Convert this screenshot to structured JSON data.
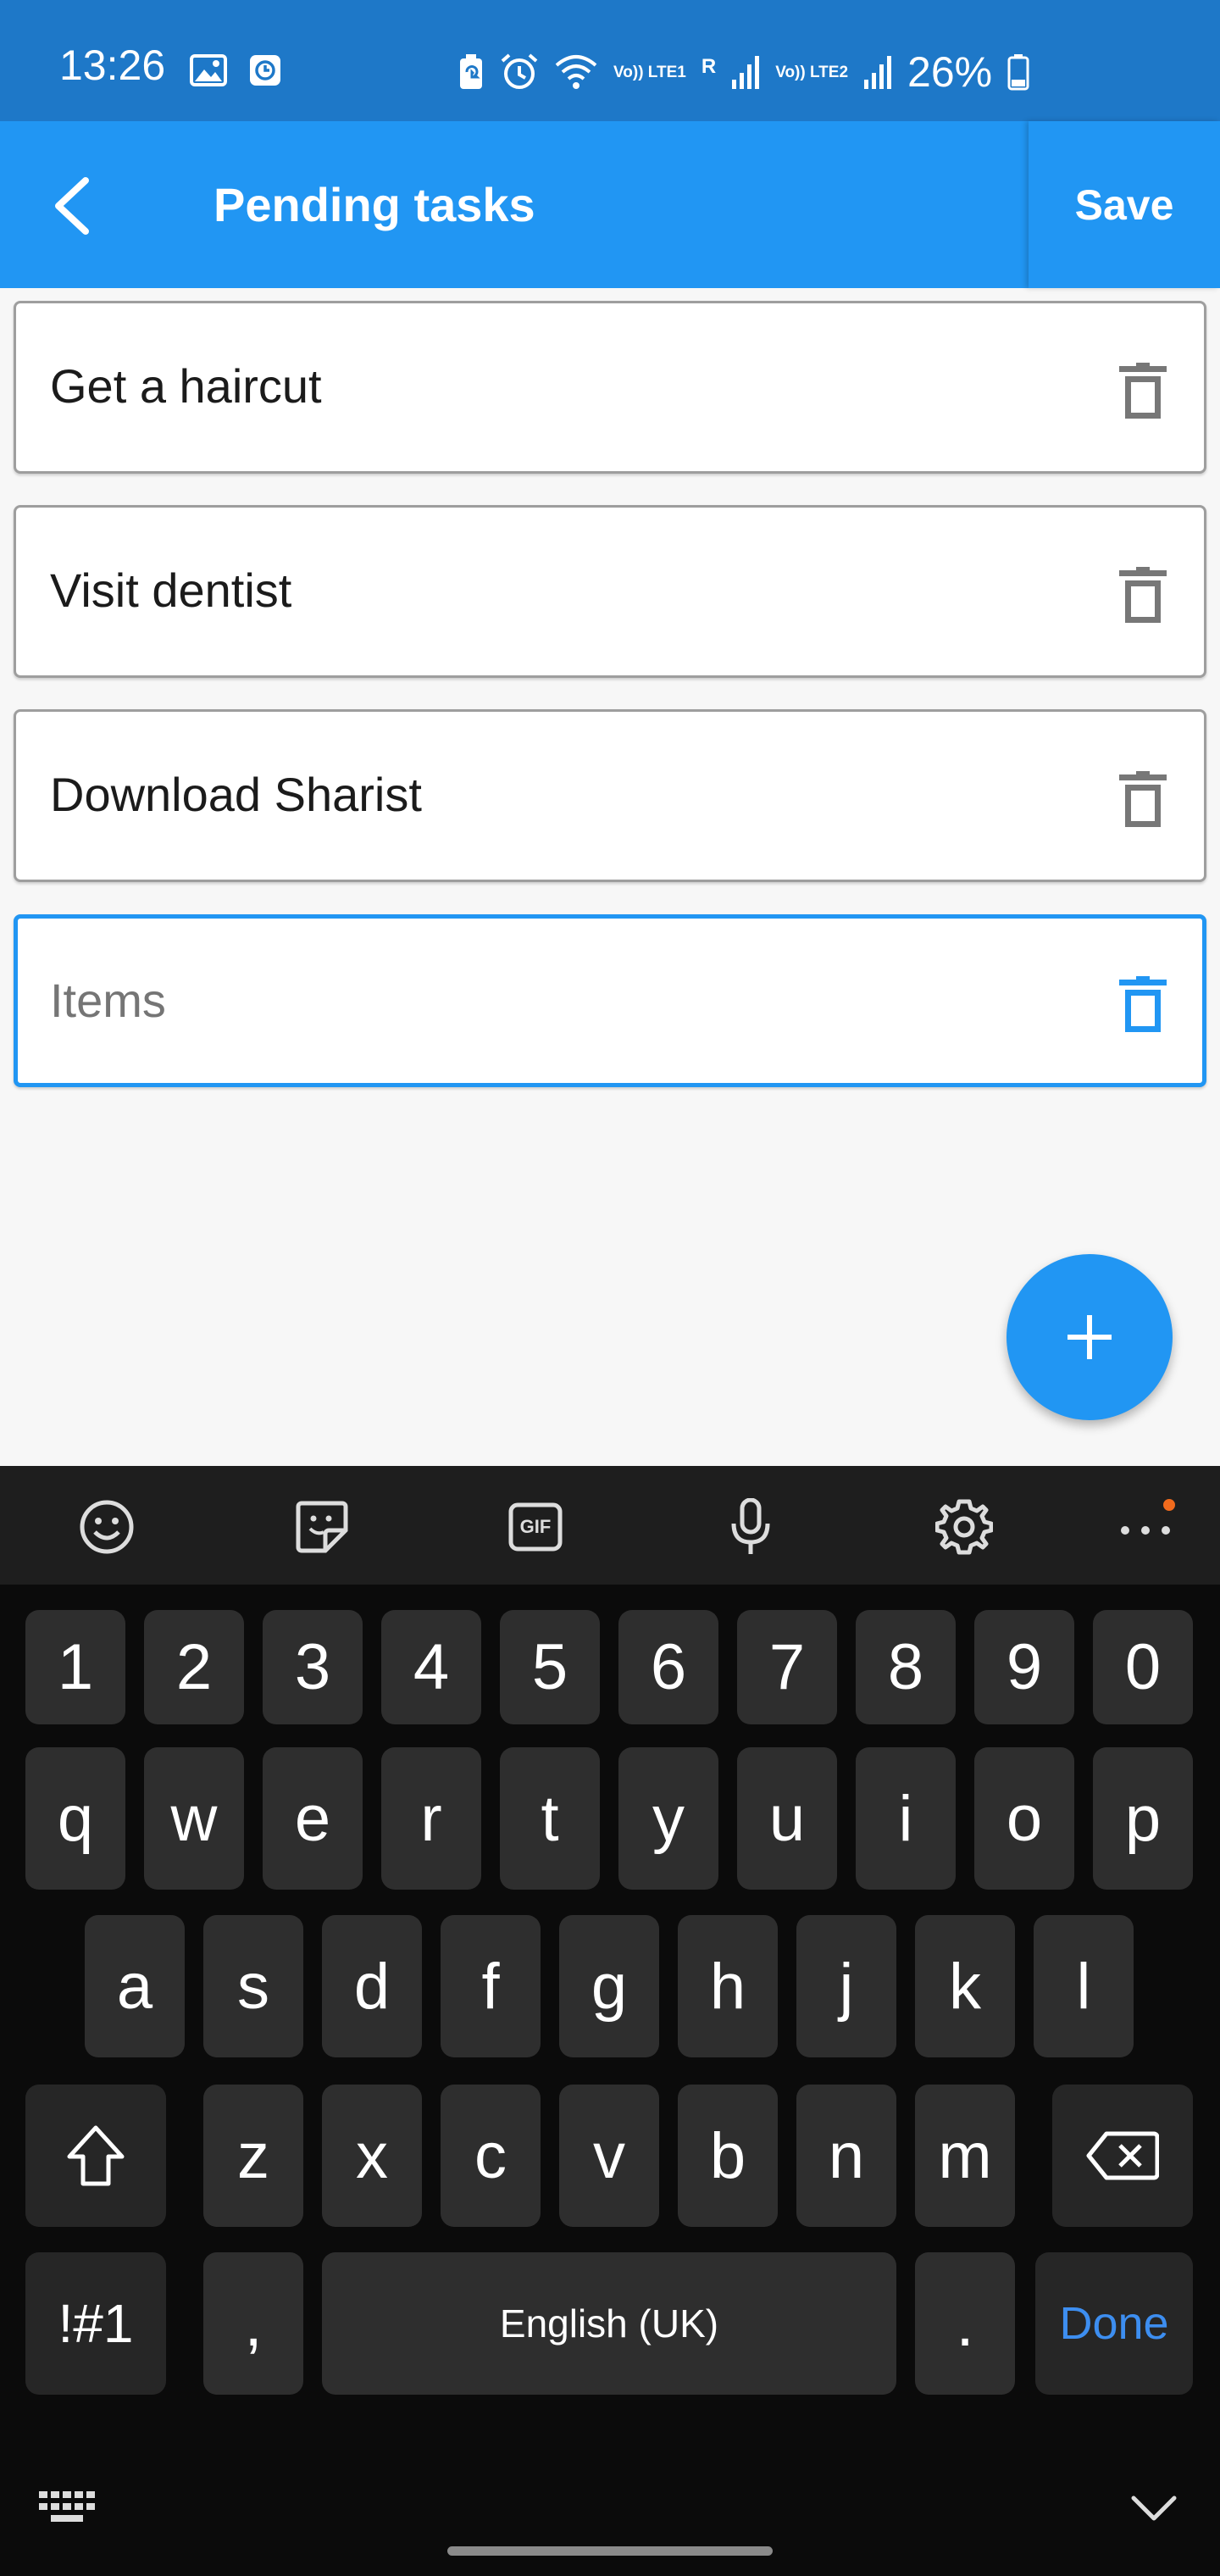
{
  "status_bar": {
    "time": "13:26",
    "battery": "26%",
    "sim1_label": "Vo)) LTE1",
    "sim1_roaming": "R",
    "sim2_label": "Vo)) LTE2",
    "icons": [
      "image-icon",
      "clock-badge-icon",
      "battery-saver-icon",
      "alarm-icon",
      "wifi-icon",
      "signal-icon",
      "signal-icon",
      "battery-icon"
    ]
  },
  "app_bar": {
    "title": "Pending tasks",
    "save_label": "Save",
    "color": "#2196f3"
  },
  "tasks": [
    {
      "text": "Get a haircut"
    },
    {
      "text": "Visit dentist"
    },
    {
      "text": "Download Sharist"
    }
  ],
  "new_item": {
    "value": "",
    "placeholder": "Items"
  },
  "keyboard": {
    "toolbar_icons": [
      "emoji-icon",
      "sticker-icon",
      "gif-icon",
      "microphone-icon",
      "settings-icon",
      "more-icon"
    ],
    "gif_text": "GIF",
    "number_row": [
      "1",
      "2",
      "3",
      "4",
      "5",
      "6",
      "7",
      "8",
      "9",
      "0"
    ],
    "row1": [
      "q",
      "w",
      "e",
      "r",
      "t",
      "y",
      "u",
      "i",
      "o",
      "p"
    ],
    "row2": [
      "a",
      "s",
      "d",
      "f",
      "g",
      "h",
      "j",
      "k",
      "l"
    ],
    "row3": [
      "z",
      "x",
      "c",
      "v",
      "b",
      "n",
      "m"
    ],
    "symbols_label": "!#1",
    "comma": ",",
    "space_label": "English (UK)",
    "period": ".",
    "done_label": "Done",
    "accent_color": "#3d8ef0"
  }
}
